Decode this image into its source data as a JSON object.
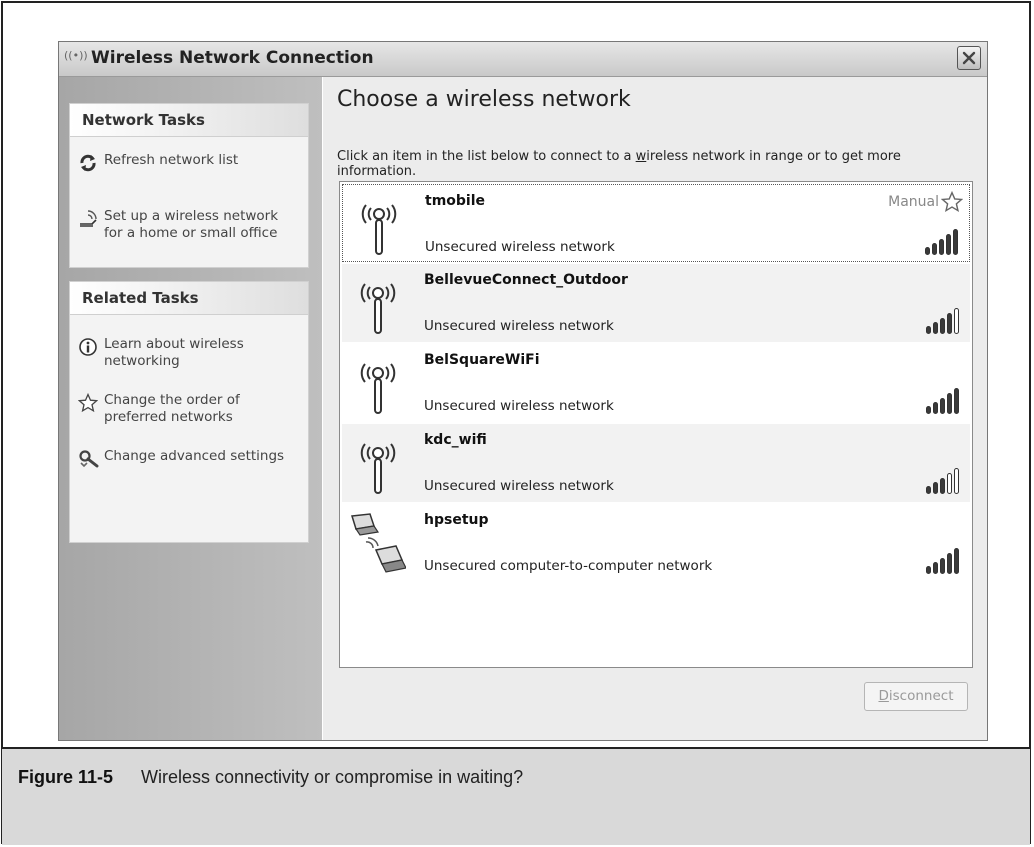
{
  "window": {
    "title": "Wireless Network Connection",
    "title_icon": "((•))",
    "close_icon": "close-icon"
  },
  "sidebar": {
    "network_tasks": {
      "heading": "Network Tasks",
      "items": [
        {
          "label": "Refresh network list",
          "icon": "refresh-icon"
        },
        {
          "label": "Set up a wireless network for a home or small office",
          "icon": "setup-wireless-icon"
        }
      ]
    },
    "related_tasks": {
      "heading": "Related Tasks",
      "items": [
        {
          "label": "Learn about wireless networking",
          "icon": "info-icon"
        },
        {
          "label": "Change the order of preferred networks",
          "icon": "star-icon"
        },
        {
          "label": "Change advanced settings",
          "icon": "settings-icon"
        }
      ]
    }
  },
  "main": {
    "heading": "Choose a wireless network",
    "description_before": "Click an item in the list below to connect to a ",
    "description_underlined": "w",
    "description_after": "ireless network in range or to get more information.",
    "networks": [
      {
        "name": "tmobile",
        "status": "Unsecured wireless network",
        "badge": "Manual",
        "signal_bars": 5,
        "type": "access-point",
        "selected": true
      },
      {
        "name": "BellevueConnect_Outdoor",
        "status": "Unsecured wireless network",
        "signal_bars": 4,
        "type": "access-point"
      },
      {
        "name": "BelSquareWiFi",
        "status": "Unsecured wireless network",
        "signal_bars": 5,
        "type": "access-point"
      },
      {
        "name": "kdc_wifi",
        "status": "Unsecured wireless network",
        "signal_bars": 3,
        "type": "access-point"
      },
      {
        "name": "hpsetup",
        "status": "Unsecured computer-to-computer network",
        "signal_bars": 5,
        "type": "computer-to-computer"
      }
    ],
    "disconnect_button": {
      "mnemonic": "D",
      "rest": "isconnect",
      "enabled": false
    }
  },
  "caption": {
    "figure_number": "Figure 11-5",
    "text": "Wireless connectivity or compromise in waiting?"
  }
}
